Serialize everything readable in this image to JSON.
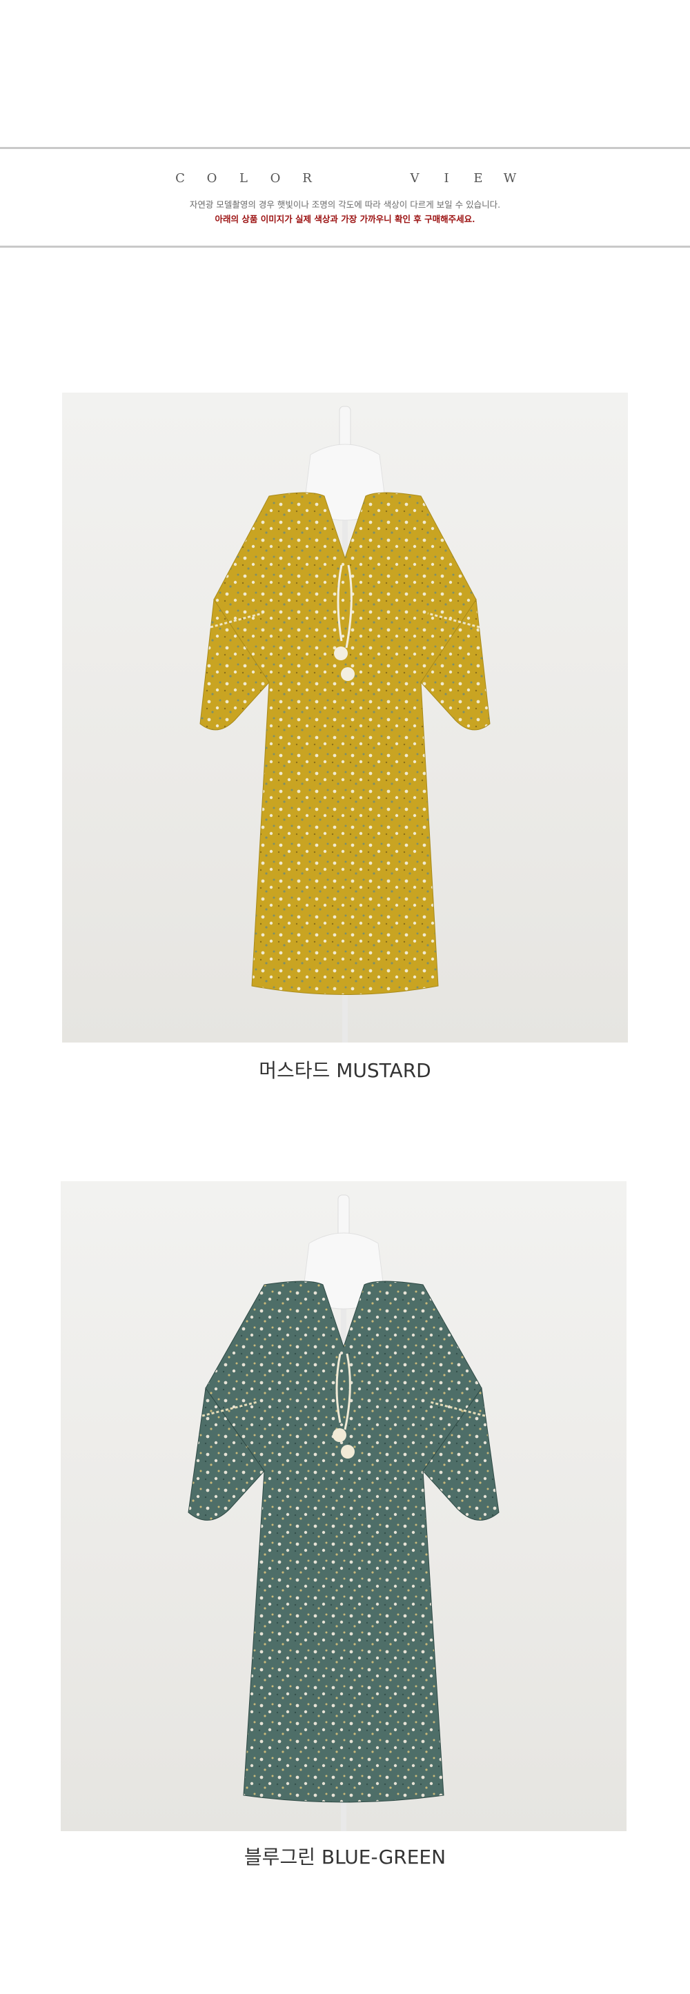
{
  "header": {
    "title_letters": [
      "C",
      "O",
      "L",
      "O",
      "R",
      "",
      "V",
      "I",
      "E",
      "W"
    ],
    "notice_line1": "자연광 모델촬영의 경우 햇빛이나 조명의 각도에 따라 색상이 다르게 보일 수 있습니다.",
    "notice_line2": "아래의 상품 이미지가 실제 색상과 가장 가까우니 확인 후 구매해주세요."
  },
  "products": [
    {
      "caption": "머스타드 MUSTARD",
      "fabric_color": "#c9a422",
      "dot_color": "#f0ead0",
      "accent_color": "#7d8f6a"
    },
    {
      "caption": "블루그린 BLUE-GREEN",
      "fabric_color": "#4e6e68",
      "dot_color": "#e8e3d6",
      "accent_color": "#c9b97a"
    }
  ]
}
